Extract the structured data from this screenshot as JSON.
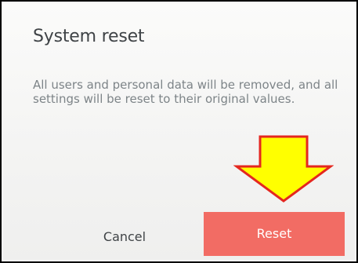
{
  "dialog": {
    "title": "System reset",
    "message": "All users and personal data will be removed, and all settings will be reset to their original values.",
    "cancel_label": "Cancel",
    "reset_label": "Reset"
  },
  "annotation": {
    "arrow_color": "#ffff00",
    "arrow_outline_color": "#e4271f",
    "icon": "down-arrow-icon"
  },
  "colors": {
    "reset_button": "#f26c64",
    "title_text": "#3f4346",
    "message_text": "#7d8488"
  }
}
